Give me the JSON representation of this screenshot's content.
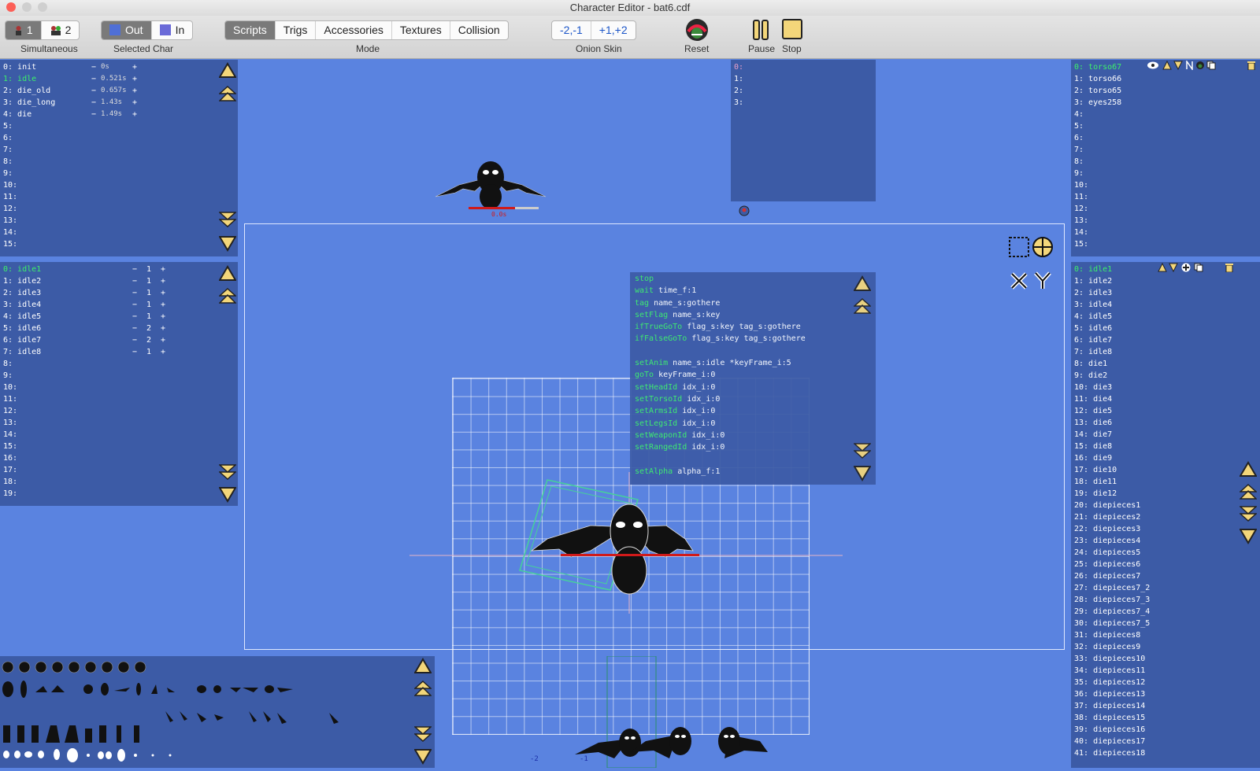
{
  "window": {
    "title": "Character Editor - bat6.cdf"
  },
  "toolbar": {
    "simultaneous": {
      "count1": "1",
      "count2": "2",
      "label": "Simultaneous"
    },
    "selected_char": {
      "out": "Out",
      "in": "In",
      "label": "Selected Char"
    },
    "mode": {
      "tabs": [
        "Scripts",
        "Trigs",
        "Accessories",
        "Textures",
        "Collision"
      ],
      "active": "Scripts",
      "label": "Mode"
    },
    "onion": {
      "minus": "-2,-1",
      "plus": "+1,+2",
      "label": "Onion Skin"
    },
    "reset_label": "Reset",
    "pause_label": "Pause",
    "stop_label": "Stop"
  },
  "anims_panel": {
    "rows": [
      {
        "label": "0: init",
        "time": "0s"
      },
      {
        "label": "1: idle",
        "time": "0.521s"
      },
      {
        "label": "2: die_old",
        "time": "0.657s"
      },
      {
        "label": "3: die_long",
        "time": "1.43s"
      },
      {
        "label": "4: die",
        "time": "1.49s"
      },
      {
        "label": "5:"
      },
      {
        "label": "6:"
      },
      {
        "label": "7:"
      },
      {
        "label": "8:"
      },
      {
        "label": "9:"
      },
      {
        "label": "10:"
      },
      {
        "label": "11:"
      },
      {
        "label": "12:"
      },
      {
        "label": "13:"
      },
      {
        "label": "14:"
      },
      {
        "label": "15:"
      }
    ]
  },
  "frames_panel": {
    "rows": [
      {
        "label": "0: idle1",
        "value": "1"
      },
      {
        "label": "1: idle2",
        "value": "1"
      },
      {
        "label": "2: idle3",
        "value": "1"
      },
      {
        "label": "3: idle4",
        "value": "1"
      },
      {
        "label": "4: idle5",
        "value": "1"
      },
      {
        "label": "5: idle6",
        "value": "2"
      },
      {
        "label": "6: idle7",
        "value": "2"
      },
      {
        "label": "7: idle8",
        "value": "1"
      },
      {
        "label": "8:"
      },
      {
        "label": "9:"
      },
      {
        "label": "10:"
      },
      {
        "label": "11:"
      },
      {
        "label": "12:"
      },
      {
        "label": "13:"
      },
      {
        "label": "14:"
      },
      {
        "label": "15:"
      },
      {
        "label": "16:"
      },
      {
        "label": "17:"
      },
      {
        "label": "18:"
      },
      {
        "label": "19:"
      }
    ]
  },
  "trigs_panel": {
    "rows": [
      "0:",
      "1:",
      "2:",
      "3:"
    ]
  },
  "parts_panel": {
    "rows": [
      "0: torso67",
      "1: torso66",
      "2: torso65",
      "3: eyes258",
      "4:",
      "5:",
      "6:",
      "7:",
      "8:",
      "9:",
      "10:",
      "11:",
      "12:",
      "13:",
      "14:",
      "15:"
    ]
  },
  "textures_panel": {
    "rows": [
      "0: idle1",
      "1: idle2",
      "2: idle3",
      "3: idle4",
      "4: idle5",
      "5: idle6",
      "6: idle7",
      "7: idle8",
      "8: die1",
      "9: die2",
      "10: die3",
      "11: die4",
      "12: die5",
      "13: die6",
      "14: die7",
      "15: die8",
      "16: die9",
      "17: die10",
      "18: die11",
      "19: die12",
      "20: diepieces1",
      "21: diepieces2",
      "22: diepieces3",
      "23: diepieces4",
      "24: diepieces5",
      "25: diepieces6",
      "26: diepieces7",
      "27: diepieces7_2",
      "28: diepieces7_3",
      "29: diepieces7_4",
      "30: diepieces7_5",
      "31: diepieces8",
      "32: diepieces9",
      "33: diepieces10",
      "34: diepieces11",
      "35: diepieces12",
      "36: diepieces13",
      "37: diepieces14",
      "38: diepieces15",
      "39: diepieces16",
      "40: diepieces17",
      "41: diepieces18"
    ]
  },
  "script": {
    "lines": [
      {
        "kw": "stop",
        "args": ""
      },
      {
        "kw": "wait",
        "args": " time_f:1"
      },
      {
        "kw": "tag",
        "args": " name_s:gothere"
      },
      {
        "kw": "setFlag",
        "args": " name_s:key"
      },
      {
        "kw": "ifTrueGoTo",
        "args": " flag_s:key tag_s:gothere"
      },
      {
        "kw": "ifFalseGoTo",
        "args": " flag_s:key tag_s:gothere"
      },
      {
        "kw": "",
        "args": ""
      },
      {
        "kw": "setAnim",
        "args": " name_s:idle *keyFrame_i:5"
      },
      {
        "kw": "goTo",
        "args": " keyFrame_i:0"
      },
      {
        "kw": "setHeadId",
        "args": " idx_i:0"
      },
      {
        "kw": "setTorsoId",
        "args": " idx_i:0"
      },
      {
        "kw": "setArmsId",
        "args": " idx_i:0"
      },
      {
        "kw": "setLegsId",
        "args": " idx_i:0"
      },
      {
        "kw": "setWeaponId",
        "args": " idx_i:0"
      },
      {
        "kw": "setRangedId",
        "args": " idx_i:0"
      },
      {
        "kw": "",
        "args": ""
      },
      {
        "kw": "setAlpha",
        "args": " alpha_f:1"
      }
    ]
  },
  "preview": {
    "time_label": "0.0s"
  },
  "onion_labels": {
    "a": "-2",
    "b": "-1"
  },
  "colors": {
    "panel": "#3c5ba6",
    "background": "#5a83e0",
    "selected": "#3cf06a",
    "accent_red": "#d01a1a"
  }
}
